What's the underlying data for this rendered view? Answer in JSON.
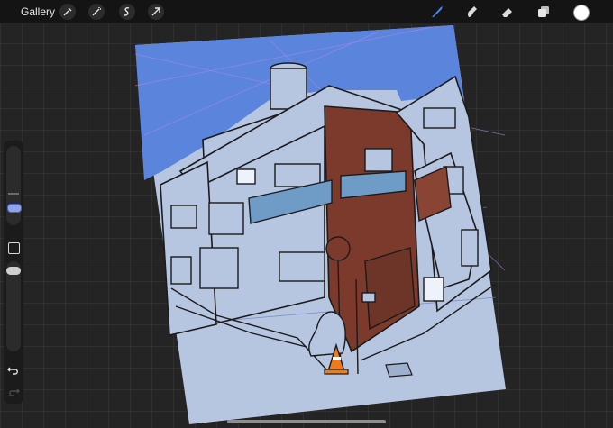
{
  "topbar": {
    "gallery_label": "Gallery",
    "left_tools": [
      "wrench-icon",
      "magic-wand-icon",
      "selection-icon",
      "transform-arrow-icon"
    ],
    "right_tools": [
      "brush-icon",
      "smudge-icon",
      "eraser-icon",
      "layers-icon"
    ],
    "active_tool": "brush",
    "current_color": "#ffffff",
    "accent_color": "#3f8cff"
  },
  "sidebar": {
    "tools": [
      "brush-size-slider",
      "modify-button",
      "opacity-slider",
      "undo-icon",
      "redo-icon"
    ]
  },
  "artwork": {
    "sky_color": "#5b84dd",
    "wall_color": "#b6c5e0",
    "brick_color": "#7b3a2b",
    "glass_color": "#6f9cc6",
    "cone_color": "#f07b19"
  }
}
